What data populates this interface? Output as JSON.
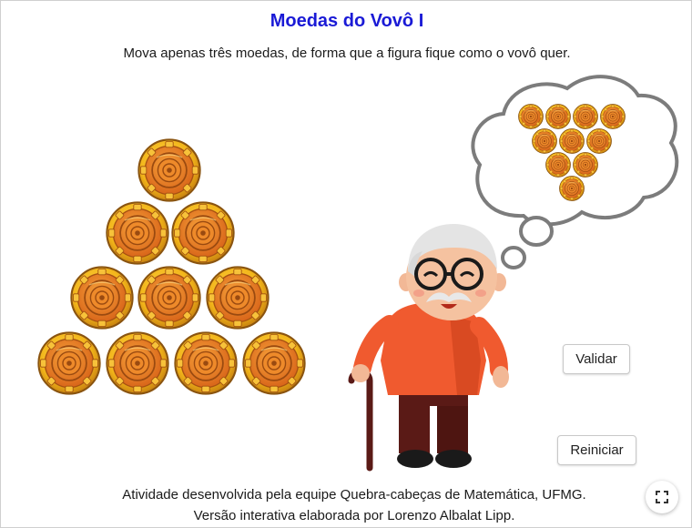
{
  "header": {
    "title": "Moedas do Vovô I",
    "subtitle": "Mova apenas três moedas, de forma que a figura fique como o vovô quer."
  },
  "coins": {
    "count": 10,
    "rows": [
      1,
      2,
      3,
      4
    ],
    "icon": "gold-coin-icon"
  },
  "thought_bubble": {
    "coin_rows": [
      4,
      3,
      2,
      1
    ],
    "icon": "thought-bubble-icon"
  },
  "grandfather": {
    "icon": "grandfather-illustration"
  },
  "buttons": {
    "validate_label": "Validar",
    "reset_label": "Reiniciar"
  },
  "footer": {
    "line1": "Atividade desenvolvida pela equipe Quebra-cabeças de Matemática, UFMG.",
    "line2": "Versão interativa elaborada por Lorenzo Albalat Lipp."
  },
  "controls": {
    "fullscreen_icon": "fullscreen-icon"
  },
  "colors": {
    "title": "#1a1ad6",
    "coin_gold": "#f2b51a",
    "coin_inner": "#e2781a",
    "shirt": "#f05a2f",
    "pants": "#5a1a16"
  }
}
